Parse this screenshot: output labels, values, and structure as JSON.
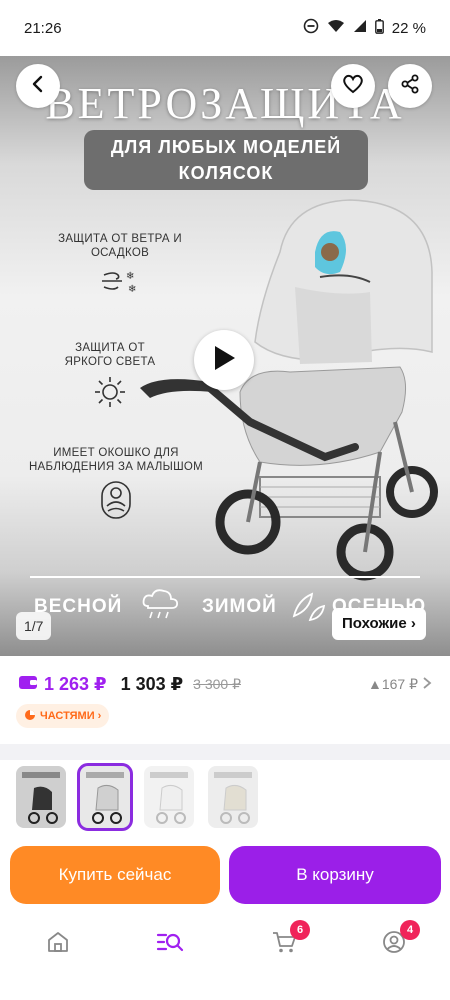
{
  "status_bar": {
    "time": "21:26",
    "battery": "22 %"
  },
  "gallery": {
    "banner_title": "ВЕТРОЗАЩИТА",
    "subtitle": "ДЛЯ ЛЮБЫХ МОДЕЛЕЙ КОЛЯСОК",
    "features": [
      {
        "text": "ЗАЩИТА ОТ ВЕТРА И ОСАДКОВ",
        "icon": "wind-snow-icon"
      },
      {
        "text": "ЗАЩИТА ОТ ЯРКОГО СВЕТА",
        "icon": "sun-icon"
      },
      {
        "text": "ИМЕЕТ ОКОШКО ДЛЯ НАБЛЮДЕНИЯ ЗА МАЛЫШОМ",
        "icon": "baby-icon"
      }
    ],
    "seasons": [
      "ВЕСНОЙ",
      "ЗИМОЙ",
      "ОСЕНЬЮ"
    ],
    "counter": "1/7",
    "similar_label": "Похожие ›"
  },
  "price": {
    "card_price": "1 263 ₽",
    "main_price": "1 303 ₽",
    "old_price": "3 300 ₽",
    "price_change": "▲167 ₽",
    "installment_label": "ЧАСТЯМИ ›"
  },
  "buttons": {
    "buy_now": "Купить сейчас",
    "add_to_cart": "В корзину"
  },
  "bottom_nav": {
    "cart_badge": "6",
    "profile_badge": "4"
  },
  "colors": {
    "accent_purple": "#9b1fe8",
    "accent_orange": "#ff8a25",
    "badge_red": "#f0245a"
  }
}
